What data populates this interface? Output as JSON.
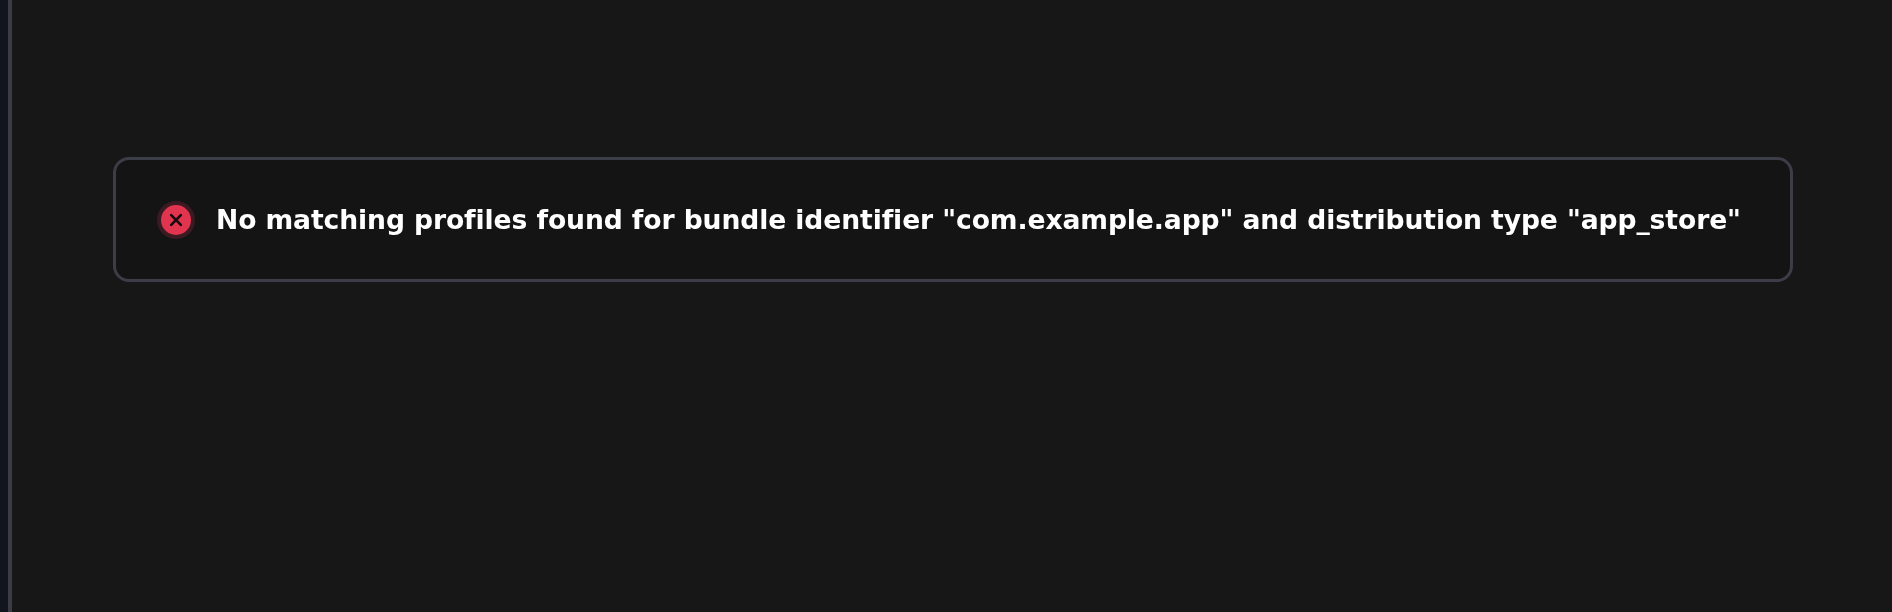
{
  "alert": {
    "kind": "error",
    "message": "No matching profiles found for bundle identifier \"com.example.app\" and distribution type \"app_store\""
  }
}
